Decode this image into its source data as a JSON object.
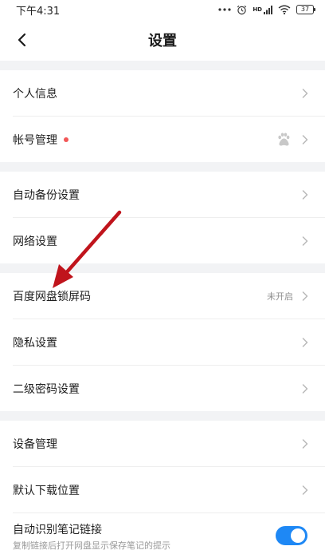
{
  "status_bar": {
    "time": "下午4:31",
    "hd_label": "HD",
    "battery": "37"
  },
  "header": {
    "title": "设置"
  },
  "groups": [
    {
      "items": [
        {
          "label": "个人信息"
        },
        {
          "label": "帐号管理",
          "badge": "red-dot",
          "trailing_icon": "baidu-paw-icon"
        }
      ]
    },
    {
      "items": [
        {
          "label": "自动备份设置"
        },
        {
          "label": "网络设置"
        }
      ]
    },
    {
      "items": [
        {
          "label": "百度网盘锁屏码",
          "value": "未开启"
        },
        {
          "label": "隐私设置"
        },
        {
          "label": "二级密码设置"
        }
      ]
    },
    {
      "items": [
        {
          "label": "设备管理"
        },
        {
          "label": "默认下载位置"
        }
      ]
    }
  ],
  "note_link_toggle": {
    "label": "自动识别笔记链接",
    "sublabel": "复制链接后打开网盘显示保存笔记的提示",
    "enabled": true
  },
  "colors": {
    "accent": "#1e88f5",
    "section_gap": "#f2f3f5",
    "badge_red": "#f25757",
    "annotation_arrow": "#c0141c"
  }
}
